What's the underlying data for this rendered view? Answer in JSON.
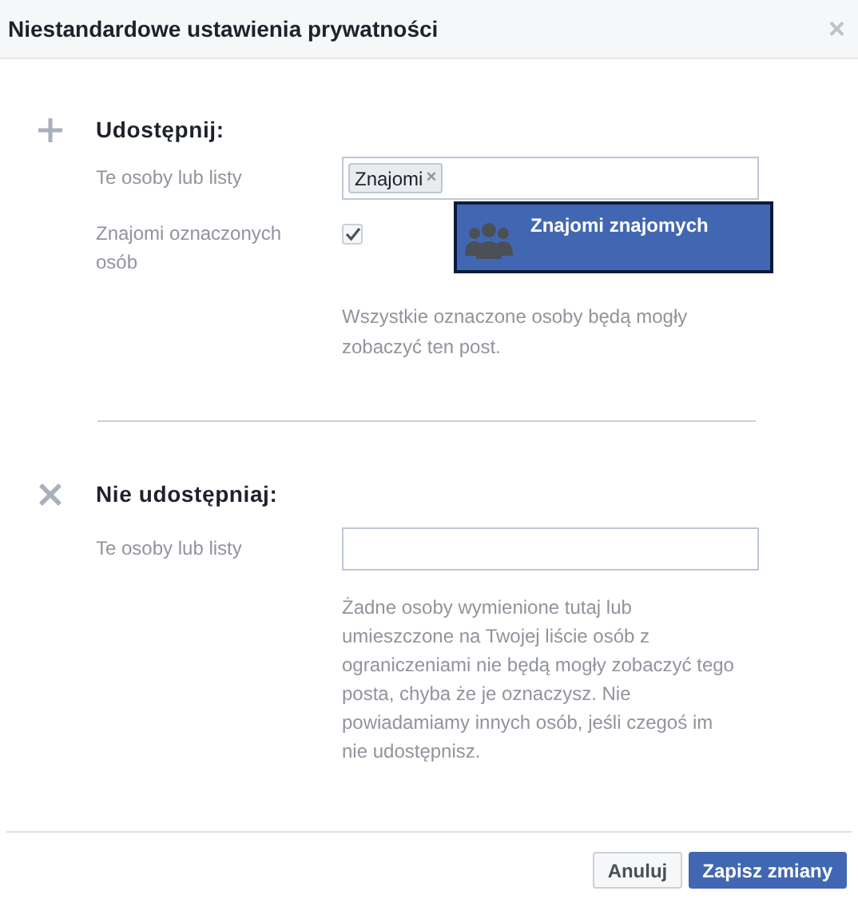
{
  "dialog": {
    "title": "Niestandardowe ustawienia prywatności",
    "close": "×"
  },
  "share": {
    "heading": "Udostępnij:",
    "people_label": "Te osoby lub listy",
    "tokens": [
      {
        "label": "Znajomi",
        "remove": "×"
      }
    ],
    "suggestion": {
      "label": "Znajomi znajomych",
      "selected": true
    },
    "tagged_label": "Znajomi oznaczonych osób",
    "tagged_checked": true,
    "note": "Wszystkie oznaczone osoby będą mogły zobaczyć ten post."
  },
  "dont_share": {
    "heading": "Nie udostępniaj:",
    "people_label": "Te osoby lub listy",
    "note": "Żadne osoby wymienione tutaj lub umieszczone na Twojej liście osób z ograniczeniami nie będą mogły zobaczyć tego posta, chyba że je oznaczysz. Nie powiadamiamy innych osób, jeśli czegoś im nie udostępnisz."
  },
  "buttons": [
    {
      "label": "Anuluj",
      "kind": "secondary"
    },
    {
      "label": "Zapisz zmiany",
      "kind": "primary"
    }
  ]
}
